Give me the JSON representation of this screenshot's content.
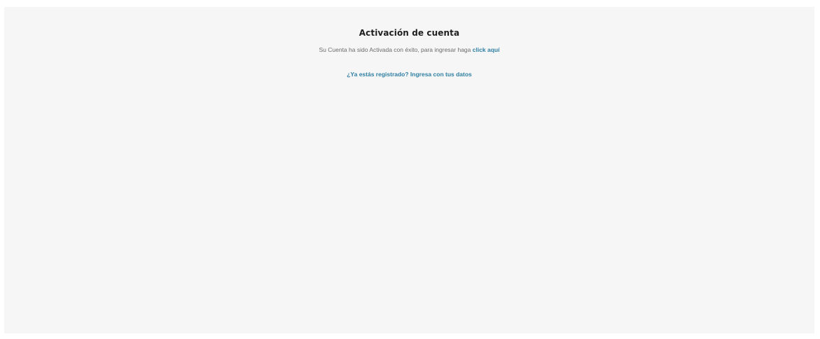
{
  "activation": {
    "title": "Activación de cuenta",
    "message_prefix": "Su Cuenta ha sido Activada con éxito, para ingresar haga ",
    "message_link": "click aquí"
  },
  "login": {
    "link_text": "¿Ya estás registrado? Ingresa con tus datos"
  }
}
